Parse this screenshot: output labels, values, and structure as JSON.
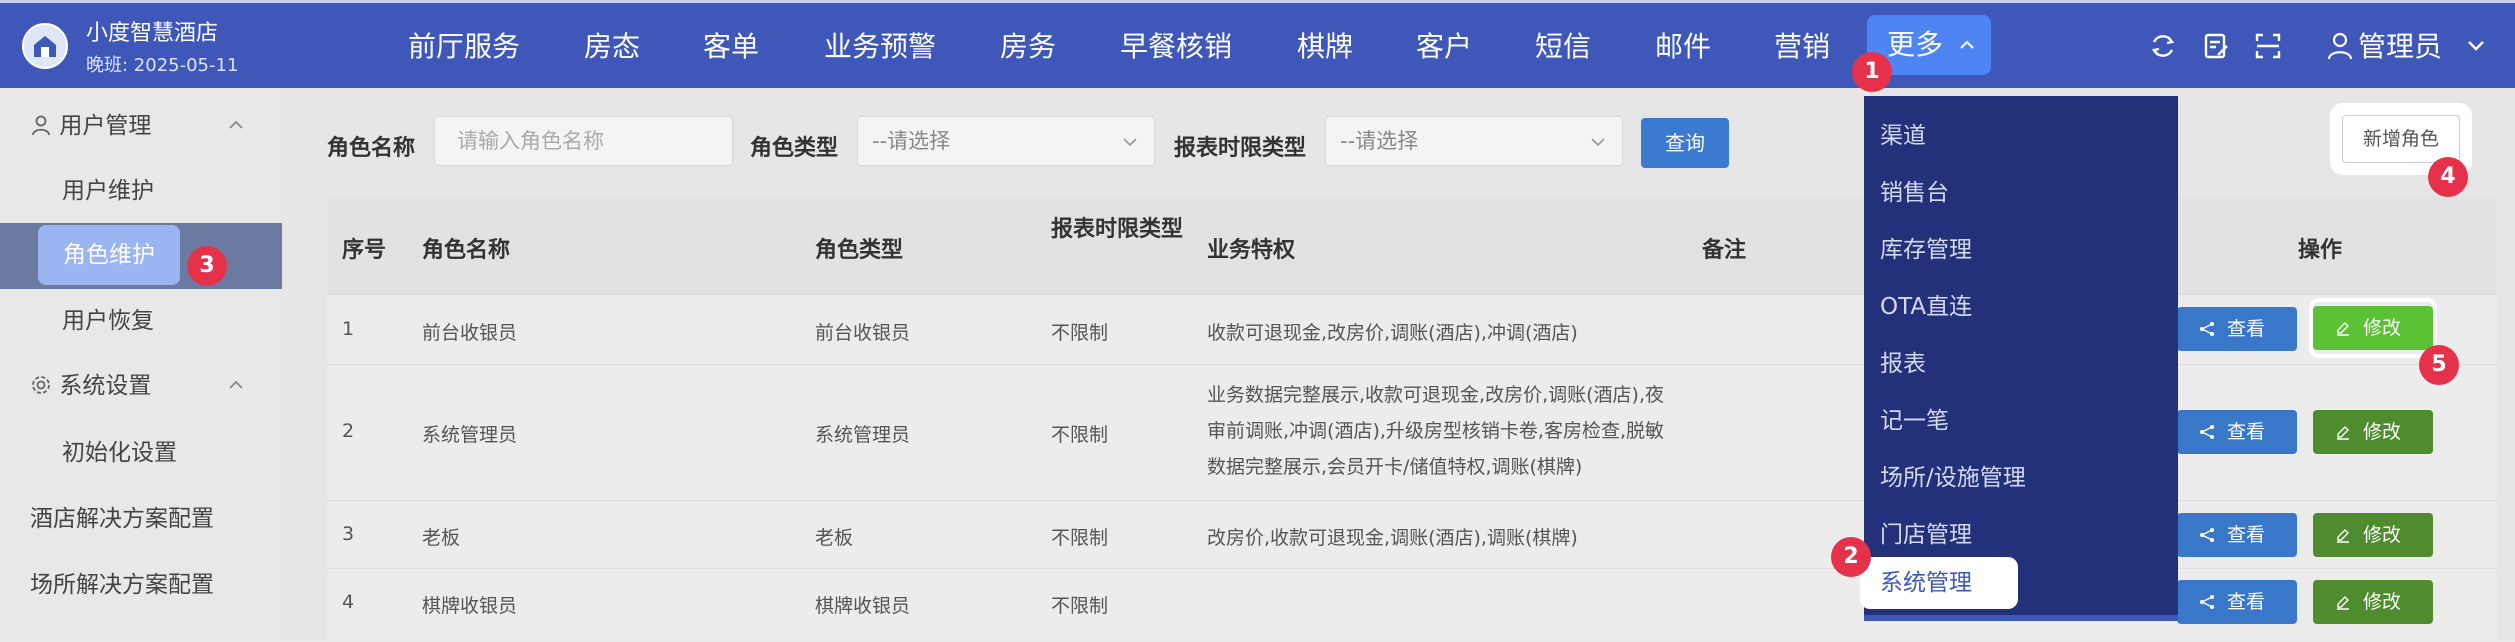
{
  "header": {
    "hotel_name": "小度智慧酒店",
    "shift": "晚班: 2025-05-11",
    "nav": [
      "前厅服务",
      "房态",
      "客单",
      "业务预警",
      "房务",
      "早餐核销",
      "棋牌",
      "客户",
      "短信",
      "邮件",
      "营销"
    ],
    "more_label": "更多",
    "user_label": "管理员"
  },
  "sidebar": {
    "group_user": "用户管理",
    "items_user": [
      "用户维护",
      "角色维护",
      "用户恢复"
    ],
    "group_system": "系统设置",
    "items_system": [
      "初始化设置"
    ],
    "hotel_solution": "酒店解决方案配置",
    "venue_solution": "场所解决方案配置"
  },
  "filters": {
    "role_name_label": "角色名称",
    "role_name_placeholder": "请输入角色名称",
    "role_type_label": "角色类型",
    "role_type_value": "--请选择",
    "report_limit_label": "报表时限类型",
    "report_limit_value": "--请选择",
    "query_label": "查询",
    "add_label": "新增角色"
  },
  "table": {
    "headers": {
      "index": "序号",
      "name": "角色名称",
      "type": "角色类型",
      "limit": "报表时限类型",
      "privileges": "业务特权",
      "remark": "备注",
      "actions": "操作"
    },
    "rows": [
      {
        "index": "1",
        "name": "前台收银员",
        "type": "前台收银员",
        "limit": "不限制",
        "privileges": "收款可退现金,改房价,调账(酒店),冲调(酒店)"
      },
      {
        "index": "2",
        "name": "系统管理员",
        "type": "系统管理员",
        "limit": "不限制",
        "privileges": "业务数据完整展示,收款可退现金,改房价,调账(酒店),夜审前调账,冲调(酒店),升级房型核销卡卷,客房检查,脱敏数据完整展示,会员开卡/储值特权,调账(棋牌)"
      },
      {
        "index": "3",
        "name": "老板",
        "type": "老板",
        "limit": "不限制",
        "privileges": "改房价,收款可退现金,调账(酒店),调账(棋牌)"
      },
      {
        "index": "4",
        "name": "棋牌收银员",
        "type": "棋牌收银员",
        "limit": "不限制",
        "privileges": ""
      }
    ],
    "view_label": "查看",
    "edit_label": "修改"
  },
  "dropdown": {
    "items": [
      "渠道",
      "销售台",
      "库存管理",
      "OTA直连",
      "报表",
      "记一笔",
      "场所/设施管理",
      "门店管理"
    ],
    "selected": "系统管理"
  },
  "markers": [
    "1",
    "2",
    "3",
    "4",
    "5"
  ],
  "colors": {
    "header_bg": "#3e57b9",
    "more_bg": "#4f84f5",
    "dropdown_bg": "#23317b",
    "view_btn": "#3978c9",
    "edit_btn": "#4e8c2d",
    "marker": "#e5324a"
  }
}
